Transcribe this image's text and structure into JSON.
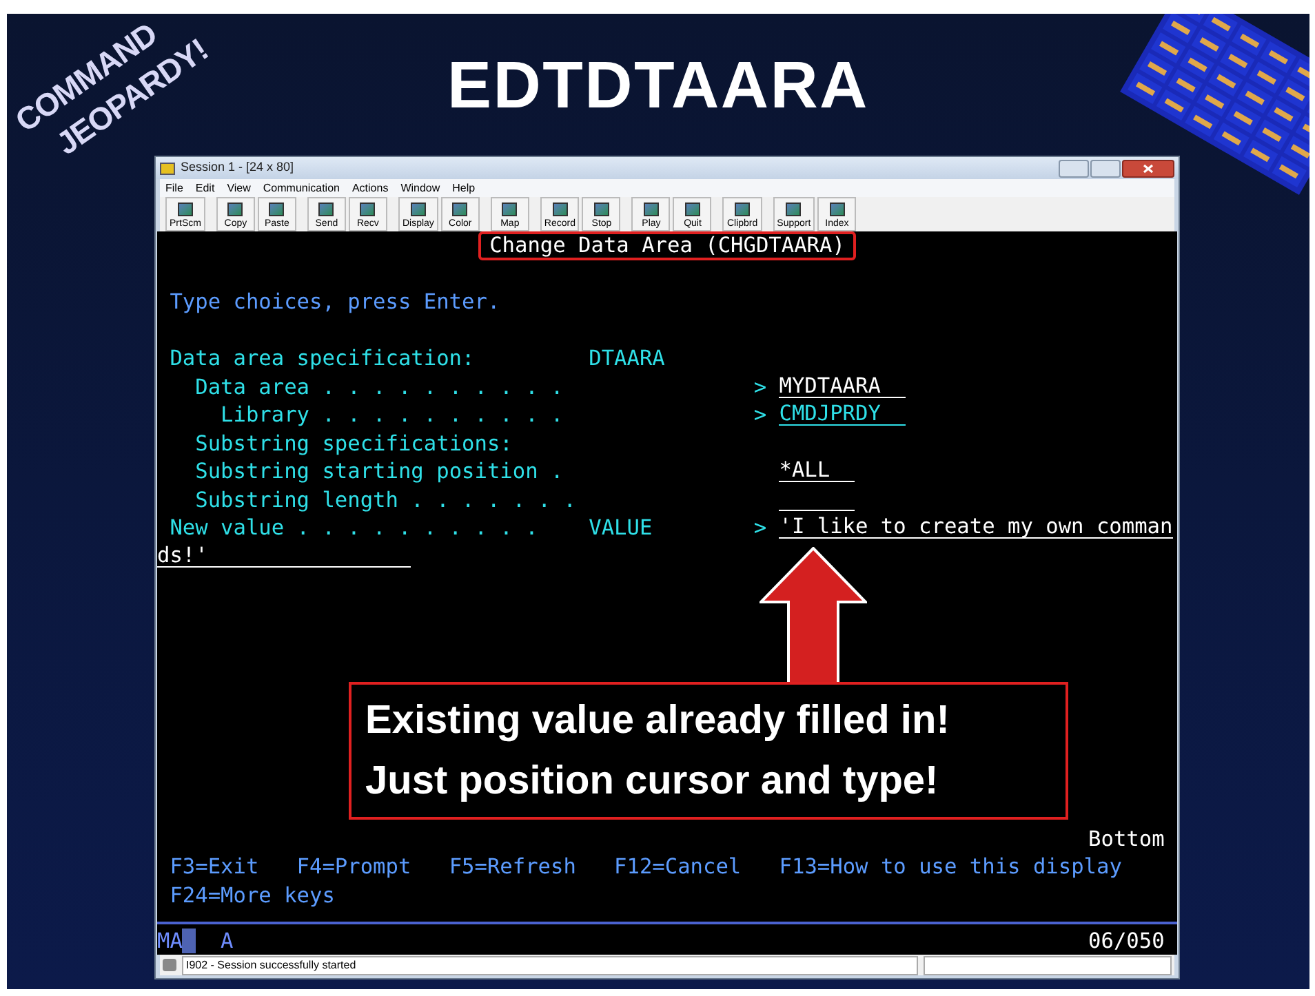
{
  "slide": {
    "title": "EDTDTAARA",
    "logo": [
      "COMMAND",
      "JEOPARDY!"
    ]
  },
  "window": {
    "title": "Session 1 - [24 x 80]"
  },
  "menu": [
    "File",
    "Edit",
    "View",
    "Communication",
    "Actions",
    "Window",
    "Help"
  ],
  "toolbar": [
    [
      "PrtScm"
    ],
    [
      "Copy",
      "Paste"
    ],
    [
      "Send",
      "Recv"
    ],
    [
      "Display",
      "Color"
    ],
    [
      "Map"
    ],
    [
      "Record",
      "Stop"
    ],
    [
      "Play",
      "Quit"
    ],
    [
      "Clipbrd"
    ],
    [
      "Support",
      "Index"
    ]
  ],
  "terminal": {
    "title": "Change Data Area (CHGDTAARA)",
    "instruction": "Type choices, press Enter.",
    "params": [
      {
        "label": "Data area specification:",
        "keyword": "DTAARA",
        "children": [
          {
            "label": "Data area . . . . . . . . . .",
            "prompt": ">",
            "value": "MYDTAARA",
            "kind": "white",
            "children": [
              {
                "label": "Library . . . . . . . . . .",
                "prompt": ">",
                "value": "CMDJPRDY",
                "kind": "cyan"
              }
            ]
          },
          {
            "label": "Substring specifications:"
          },
          {
            "label": "Substring starting position .",
            "value": "*ALL",
            "kind": "white"
          },
          {
            "label": "Substring length . . . . . . .",
            "kind": "white"
          }
        ]
      },
      {
        "label": "New value . . . . . . . . . .",
        "keyword": "VALUE",
        "prompt": ">",
        "value": "'I like to create my own comman",
        "continuation": "ds!'",
        "kind": "white"
      }
    ],
    "more": "Bottom",
    "fkeys": [
      [
        "F3=Exit",
        "F4=Prompt",
        "F5=Refresh",
        "F12=Cancel",
        "F13=How to use this display"
      ],
      [
        "F24=More keys"
      ]
    ],
    "oia": {
      "mode": "MA",
      "indicator": "A",
      "position": "06/050"
    }
  },
  "status_bar": "I902 - Session successfully started",
  "callout": [
    "Existing value already filled in!",
    "Just position cursor and type!"
  ]
}
